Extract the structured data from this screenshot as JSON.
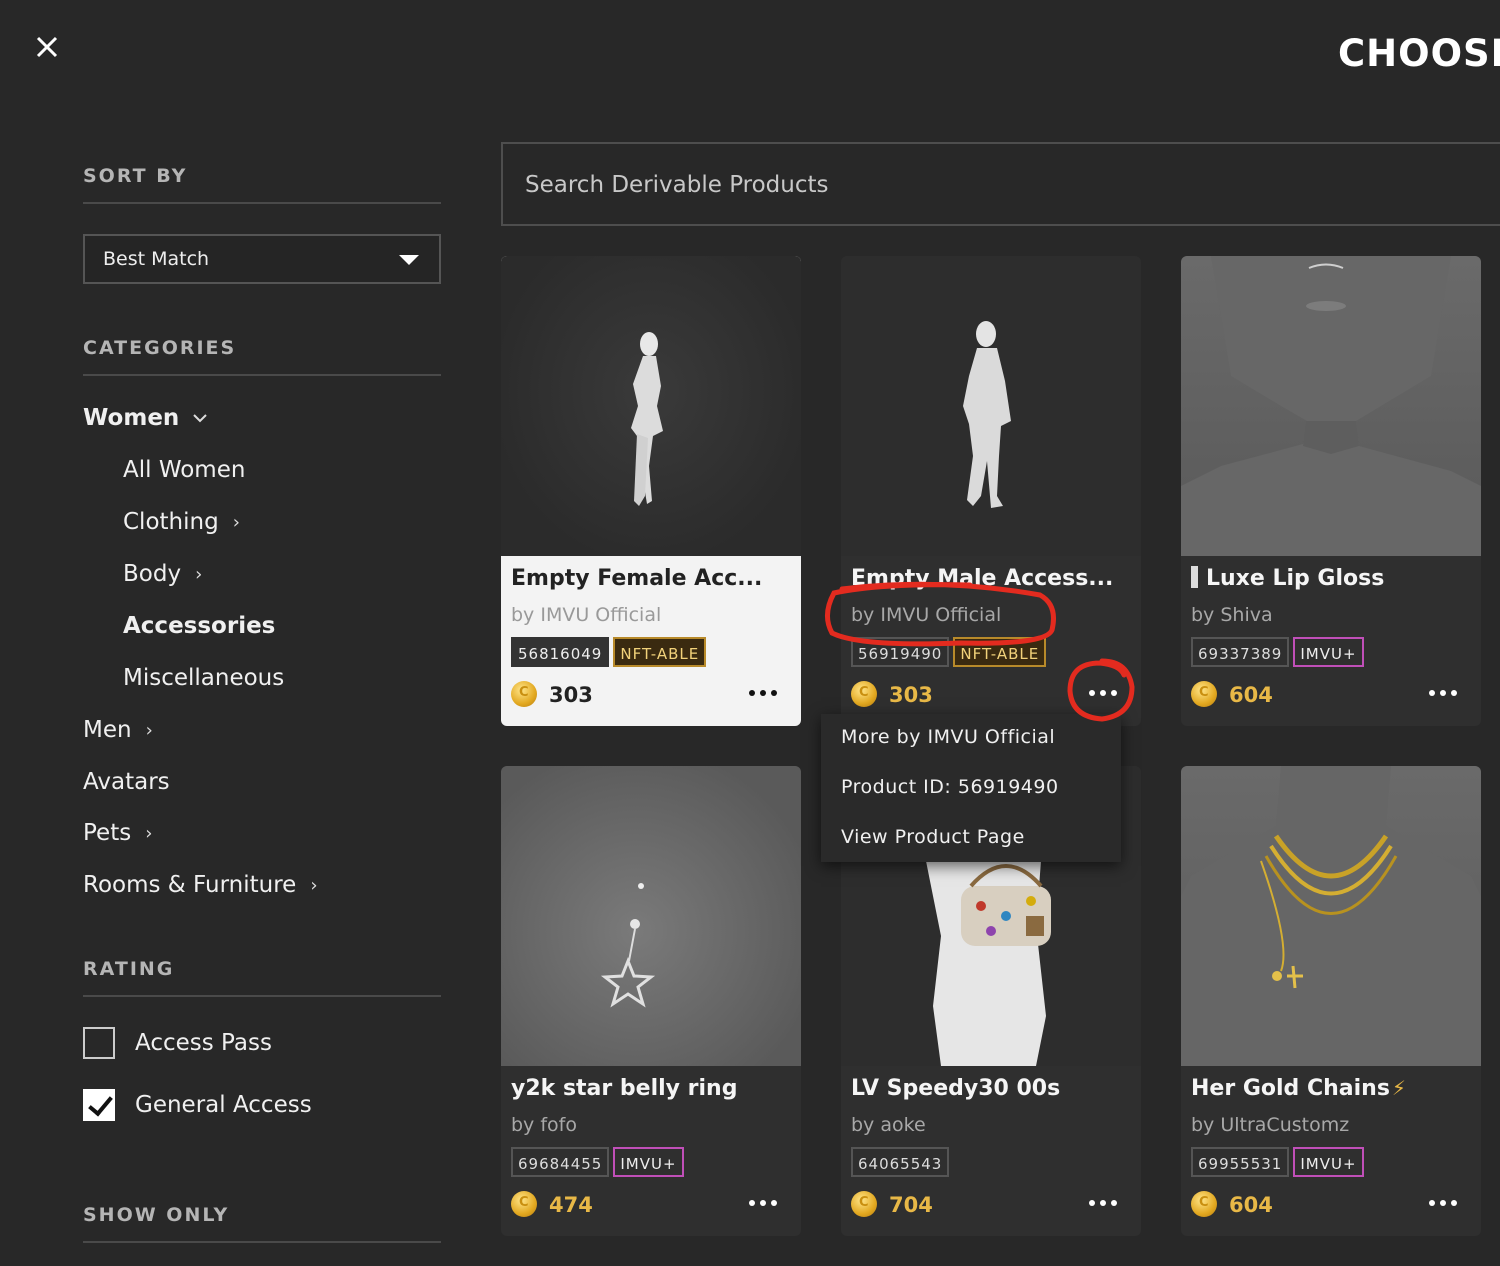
{
  "header": {
    "title": "CHOOSE"
  },
  "sidebar": {
    "sort_heading": "SORT BY",
    "sort_value": "Best Match",
    "categories_heading": "CATEGORIES",
    "women": {
      "label": "Women",
      "children": [
        "All Women",
        "Clothing",
        "Body",
        "Accessories",
        "Miscellaneous"
      ]
    },
    "top_categories": [
      "Men",
      "Avatars",
      "Pets",
      "Rooms & Furniture"
    ],
    "rating_heading": "RATING",
    "rating_options": [
      {
        "label": "Access Pass",
        "checked": false
      },
      {
        "label": "General Access",
        "checked": true
      }
    ],
    "show_only_heading": "SHOW ONLY"
  },
  "search": {
    "placeholder": "Search Derivable Products"
  },
  "products": [
    {
      "title": "Empty Female Acc...",
      "author": "by IMVU Official",
      "id": "56816049",
      "badge": "NFT-ABLE",
      "price": "303",
      "highlighted": true
    },
    {
      "title": "Empty Male Access...",
      "author": "by IMVU Official",
      "id": "56919490",
      "badge": "NFT-ABLE",
      "price": "303",
      "highlighted": false
    },
    {
      "title": "Luxe Lip Gloss",
      "author": "by Shiva",
      "id": "69337389",
      "badge": "IMVU+",
      "price": "604",
      "highlighted": false
    },
    {
      "title": "y2k star belly ring",
      "author": "by fofo",
      "id": "69684455",
      "badge": "IMVU+",
      "price": "474",
      "highlighted": false
    },
    {
      "title": "LV Speedy30 00s",
      "author": "by aoke",
      "id": "64065543",
      "badge": "",
      "price": "704",
      "highlighted": false
    },
    {
      "title": "Her Gold Chains",
      "author": "by UltraCustomz",
      "id": "69955531",
      "badge": "IMVU+",
      "price": "604",
      "highlighted": false
    }
  ],
  "context_menu": {
    "items": [
      "More by IMVU Official",
      "Product ID: 56919490",
      "View Product Page"
    ]
  },
  "colors": {
    "background": "#282828",
    "price_gold": "#e8b847",
    "annotation_red": "#e32b1f",
    "imvu_plus_border": "#c04fb8"
  }
}
